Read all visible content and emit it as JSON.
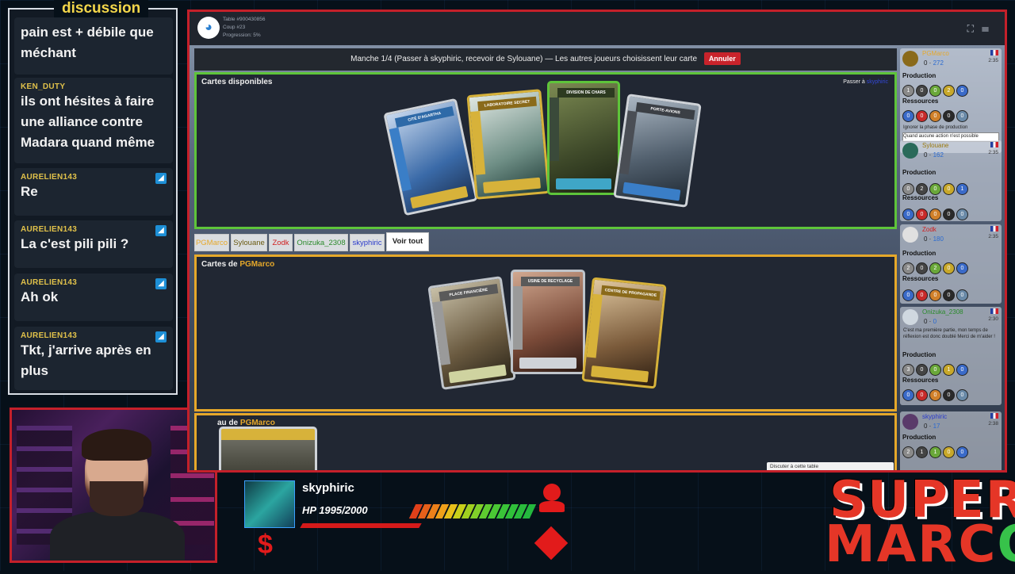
{
  "chat": {
    "title": "discussion",
    "messages": [
      {
        "user": "",
        "text": "pain est + débile que méchant"
      },
      {
        "user": "KEN_DUTY",
        "text": "ils ont hésites à faire une alliance contre Madara quand même"
      },
      {
        "user": "AURELIEN143",
        "text": "Re"
      },
      {
        "user": "AURELIEN143",
        "text": "La c'est pili pili ?"
      },
      {
        "user": "AURELIEN143",
        "text": "Ah ok"
      },
      {
        "user": "AURELIEN143",
        "text": "Tkt, j'arrive après en plus"
      }
    ]
  },
  "game": {
    "table_info": [
      "Table #900430856",
      "Coup #23",
      "Progression: 5%"
    ],
    "banner": {
      "text": "Manche 1/4 (Passer à skyphiric, recevoir de Sylouane) — Les autres joueurs choisissent leur carte",
      "cancel_label": "Annuler"
    },
    "available": {
      "title": "Cartes disponibles",
      "pass_prefix": "Passer à",
      "pass_target": "skyphiric",
      "cards": [
        {
          "name": "CITÉ D'AGARTHA",
          "theme": "ice"
        },
        {
          "name": "LABORATOIRE SECRET",
          "theme": "lab"
        },
        {
          "name": "DIVISION DE CHARS",
          "theme": "tank"
        },
        {
          "name": "PORTE-AVIONS",
          "theme": "sea"
        }
      ]
    },
    "tabs": [
      {
        "label": "PGMarco",
        "color": "#e6a82a"
      },
      {
        "label": "Sylouane",
        "color": "#9a7a10"
      },
      {
        "label": "Zodk",
        "color": "#d02020"
      },
      {
        "label": "Onizuka_2308",
        "color": "#2a8a2a"
      },
      {
        "label": "skyphiric",
        "color": "#2a3acb"
      },
      {
        "label": "Voir tout",
        "color": "#222222"
      }
    ],
    "hand": {
      "title_prefix": "Cartes de",
      "owner": "PGMarco",
      "cards": [
        {
          "name": "PLACE FINANCIÈRE",
          "theme": "bank"
        },
        {
          "name": "USINE DE RECYCLAGE",
          "theme": "factory"
        },
        {
          "name": "CENTRE DE PROPAGANDE",
          "theme": "city"
        }
      ]
    },
    "board": {
      "title_prefix": "au de",
      "owner": "PGMarco"
    },
    "chat_button": "Discuter à cette table",
    "players": [
      {
        "name": "PGMarco",
        "color": "#e6a82a",
        "score": "0",
        "bonus": "272",
        "time": "2:35",
        "prod_label": "Production",
        "prod": [
          "1",
          "0",
          "0",
          "2",
          "0"
        ],
        "res_label": "Ressources",
        "res": [
          "0",
          "0",
          "0",
          "0",
          "0"
        ],
        "note": "Ignorer la phase de production",
        "select": "Quand aucune action n'est possible"
      },
      {
        "name": "Sylouane",
        "color": "#9a7a10",
        "score": "0",
        "bonus": "162",
        "time": "2:35",
        "prod_label": "Production",
        "prod": [
          "0",
          "2",
          "0",
          "0",
          "1"
        ],
        "res_label": "Ressources",
        "res": [
          "0",
          "0",
          "0",
          "0",
          "0"
        ]
      },
      {
        "name": "Zodk",
        "color": "#d02020",
        "score": "0",
        "bonus": "180",
        "time": "2:35",
        "prod_label": "Production",
        "prod": [
          "2",
          "0",
          "2",
          "0",
          "0"
        ],
        "res_label": "Ressources",
        "res": [
          "0",
          "0",
          "0",
          "0",
          "0"
        ]
      },
      {
        "name": "Onizuka_2308",
        "color": "#2a8a2a",
        "score": "0",
        "bonus": "0",
        "time": "2:30",
        "message": "C'est ma première partie, mon temps de réflexion est donc doublé Merci de m'aider !",
        "prod_label": "Production",
        "prod": [
          "3",
          "0",
          "0",
          "1",
          "0"
        ],
        "res_label": "Ressources",
        "res": [
          "0",
          "0",
          "0",
          "0",
          "0"
        ]
      },
      {
        "name": "skyphiric",
        "color": "#2a3acb",
        "score": "0",
        "bonus": "17",
        "time": "2:38",
        "prod_label": "Production",
        "prod": [
          "2",
          "1",
          "1",
          "0",
          "0"
        ]
      }
    ]
  },
  "hud": {
    "name": "skyphiric",
    "hp_text": "HP 1995/2000",
    "dollar": "$",
    "hp_fraction": 0.9975
  },
  "logo": {
    "line1": "SUPER",
    "line2_a": "MARC",
    "line2_b": "O"
  },
  "colors": {
    "accent_red": "#c4202a",
    "available_border": "#5ec43a",
    "hand_border": "#e6a82a"
  }
}
